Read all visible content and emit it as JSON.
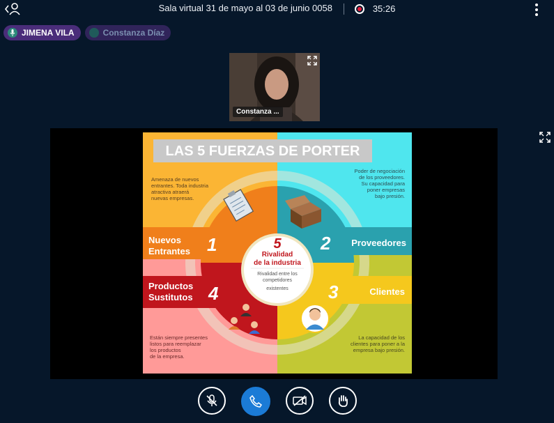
{
  "meeting": {
    "title": "Sala virtual 31 de mayo al 03 de junio 0058",
    "timer": "35:26"
  },
  "talkers": [
    {
      "name": "JIMENA VILA"
    },
    {
      "name": "Constanza Díaz"
    }
  ],
  "webcam": {
    "name": "Constanza ..."
  },
  "slide": {
    "title": "LAS 5 FUERZAS DE PORTER",
    "forces": {
      "entrants": {
        "number": "1",
        "label1": "Nuevos",
        "label2": "Entrantes",
        "desc": [
          "Amenaza de nuevos",
          "entrantes. Toda industria",
          "atractiva atraerá",
          "nuevas empresas."
        ]
      },
      "suppliers": {
        "number": "2",
        "label": "Proveedores",
        "desc": [
          "Poder de negociación",
          "de los proveedores.",
          "Su capacidad para",
          "poner empresas",
          "bajo presión."
        ]
      },
      "clients": {
        "number": "3",
        "label": "Clientes",
        "desc": [
          "La capacidad de los",
          "clientes para poner a la",
          "empresa bajo presión."
        ]
      },
      "substitutes": {
        "number": "4",
        "label1": "Productos",
        "label2": "Sustitutos",
        "desc": [
          "Están siempre presentes",
          "listos para reemplazar",
          "los productos",
          "de la empresa."
        ]
      },
      "rivalry": {
        "number": "5",
        "label1": "Rivalidad",
        "label2": "de la industria",
        "desc": [
          "Rivalidad entre los",
          "competidores",
          "existentes"
        ]
      }
    }
  },
  "colors": {
    "background": "#06172a",
    "accent_blue": "#1b7bd6",
    "recording_red": "#e81b3a",
    "orange": "#f07f1b",
    "teal": "#2aa1ae",
    "yellow": "#f5c81d",
    "red": "#c0161d"
  },
  "icons": {
    "users": "users-icon",
    "more": "more-vertical-icon",
    "mic": "microphone-muted-icon",
    "phone": "phone-icon",
    "camera": "camera-off-icon",
    "hand": "raise-hand-icon"
  }
}
